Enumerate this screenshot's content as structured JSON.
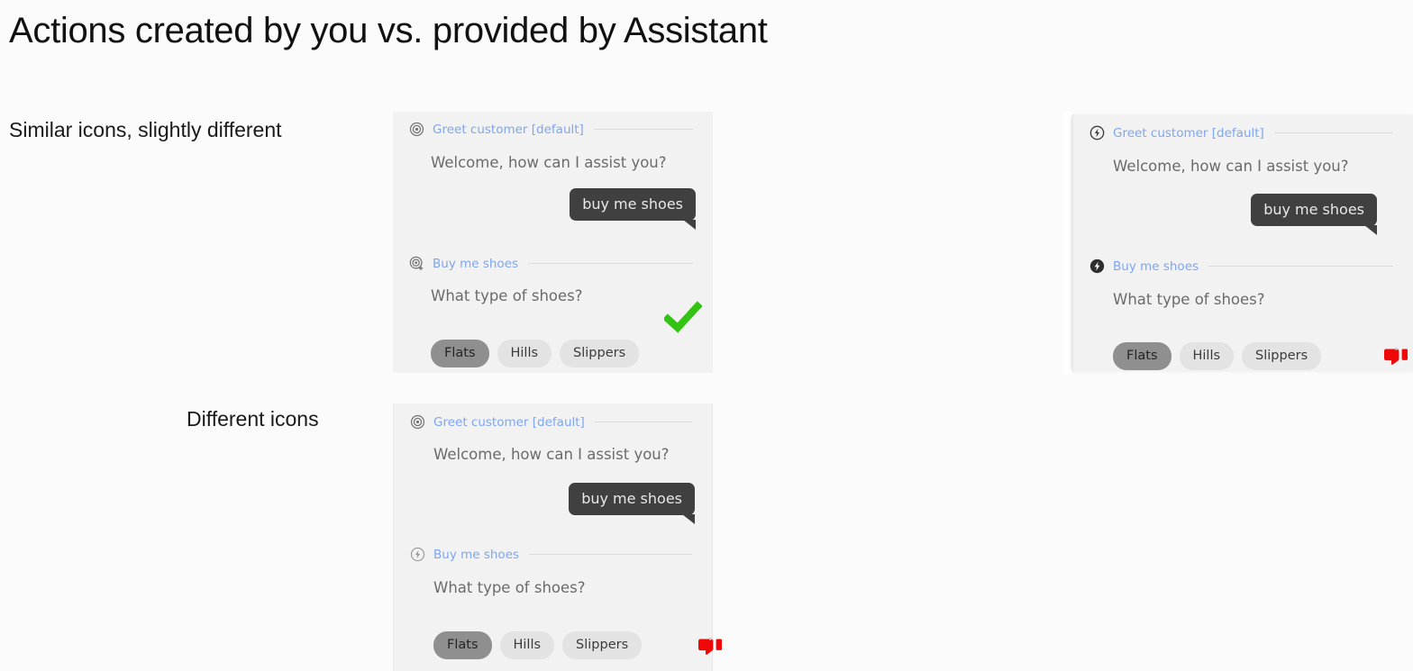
{
  "page": {
    "title": "Actions created by you vs. provided by Assistant",
    "background_color": "#fbfbfb"
  },
  "colors": {
    "card_background": "#f2f2f2",
    "section_title_blue": "#7ea6f0",
    "bot_text_gray": "#6b6b6b",
    "user_bubble_dark": "#404040",
    "chip_background": "#e3e3e3",
    "chip_selected_background": "#8f8f8f",
    "verdict_good_green": "#33c413",
    "verdict_bad_red": "#f00808"
  },
  "rows": [
    {
      "label": "Similar icons, slightly different"
    },
    {
      "label": "Different icons"
    }
  ],
  "cards": [
    {
      "id": "created-by-you-similar",
      "sections": [
        {
          "icon": "target-circle-icon",
          "title": "Greet customer [default]"
        },
        {
          "icon": "target-circle-plus-icon",
          "title": "Buy me shoes"
        }
      ],
      "bot_messages": [
        "Welcome, how can I assist you?",
        "What type of shoes?"
      ],
      "user_message": "buy me shoes",
      "chips": [
        {
          "label": "Flats",
          "selected": true
        },
        {
          "label": "Hills",
          "selected": false
        },
        {
          "label": "Slippers",
          "selected": false
        }
      ],
      "verdict": {
        "icon": "check-mark-icon",
        "glyph": "✔",
        "color": "#33c413"
      }
    },
    {
      "id": "provided-by-assistant-similar",
      "sections": [
        {
          "icon": "bolt-circle-outline-icon",
          "title": "Greet customer [default]"
        },
        {
          "icon": "bolt-circle-filled-icon",
          "title": "Buy me shoes"
        }
      ],
      "bot_messages": [
        "Welcome, how can I assist you?",
        "What type of shoes?"
      ],
      "user_message": "buy me shoes",
      "chips": [
        {
          "label": "Flats",
          "selected": true
        },
        {
          "label": "Hills",
          "selected": false
        },
        {
          "label": "Slippers",
          "selected": false
        }
      ],
      "verdict": {
        "icon": "thumbs-down-icon",
        "glyph": "👎",
        "color": "#f00808"
      }
    },
    {
      "id": "created-by-you-different",
      "sections": [
        {
          "icon": "target-circle-icon",
          "title": "Greet customer [default]"
        },
        {
          "icon": "bolt-circle-outline-light-icon",
          "title": "Buy me shoes"
        }
      ],
      "bot_messages": [
        "Welcome, how can I assist you?",
        "What type of shoes?"
      ],
      "user_message": "buy me shoes",
      "chips": [
        {
          "label": "Flats",
          "selected": true
        },
        {
          "label": "Hills",
          "selected": false
        },
        {
          "label": "Slippers",
          "selected": false
        }
      ],
      "verdict": {
        "icon": "thumbs-down-icon",
        "glyph": "👎",
        "color": "#f00808"
      }
    }
  ]
}
